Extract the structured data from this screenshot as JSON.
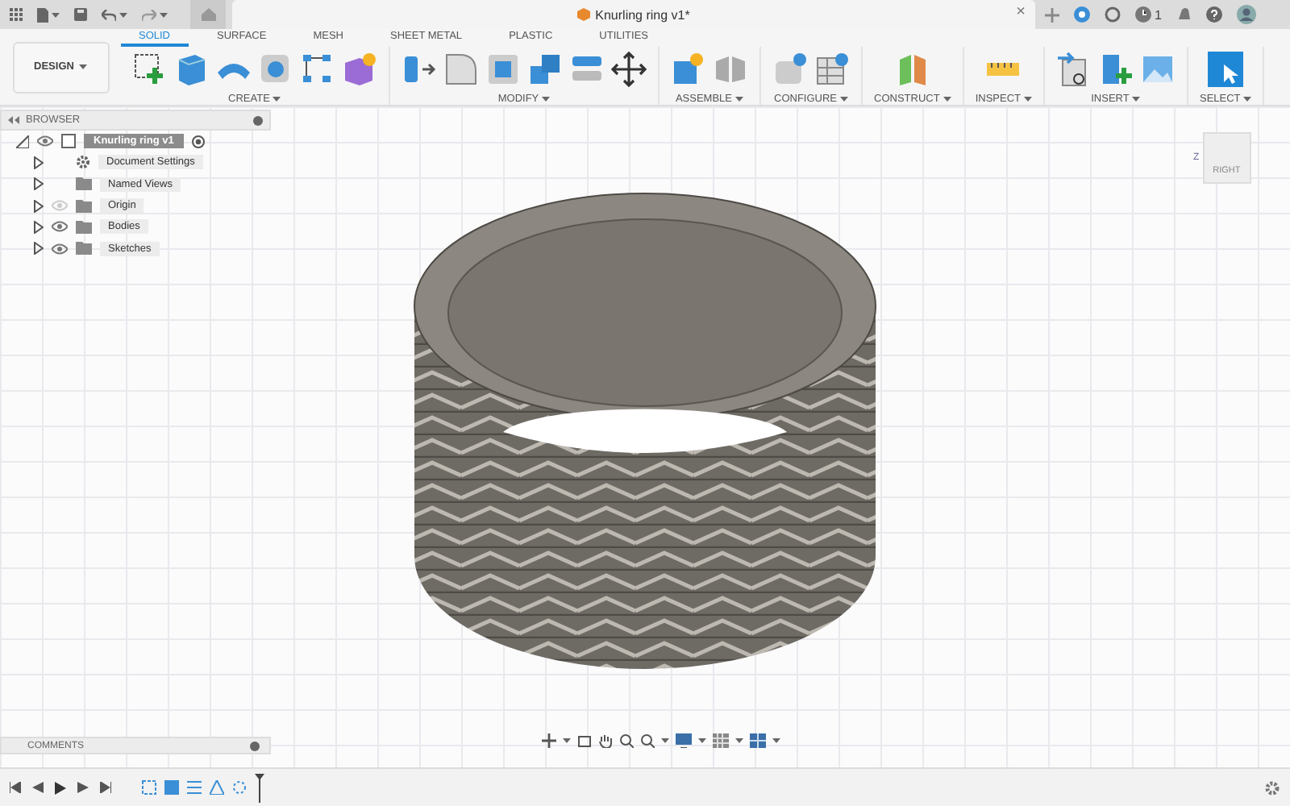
{
  "topbar": {
    "document_title": "Knurling ring v1*",
    "close": "×",
    "notification_count": "1"
  },
  "workspace": {
    "label": "DESIGN"
  },
  "tabs": [
    {
      "label": "SOLID",
      "selected": true
    },
    {
      "label": "SURFACE",
      "selected": false
    },
    {
      "label": "MESH",
      "selected": false
    },
    {
      "label": "SHEET METAL",
      "selected": false
    },
    {
      "label": "PLASTIC",
      "selected": false
    },
    {
      "label": "UTILITIES",
      "selected": false
    }
  ],
  "tool_groups": [
    {
      "label": "CREATE"
    },
    {
      "label": "MODIFY"
    },
    {
      "label": "ASSEMBLE"
    },
    {
      "label": "CONFIGURE"
    },
    {
      "label": "CONSTRUCT"
    },
    {
      "label": "INSPECT"
    },
    {
      "label": "INSERT"
    },
    {
      "label": "SELECT"
    }
  ],
  "browser": {
    "title": "BROWSER",
    "root": {
      "label": "Knurling ring v1",
      "expanded": true,
      "visible": true,
      "children": [
        {
          "label": "Document Settings",
          "kind": "settings",
          "expanded": false
        },
        {
          "label": "Named Views",
          "kind": "folder",
          "expanded": false
        },
        {
          "label": "Origin",
          "kind": "layer",
          "expanded": false,
          "visible": false
        },
        {
          "label": "Bodies",
          "kind": "layer",
          "expanded": false,
          "visible": true
        },
        {
          "label": "Sketches",
          "kind": "layer",
          "expanded": false,
          "visible": true
        }
      ]
    }
  },
  "viewcube": {
    "face": "RIGHT",
    "axis_label": "Z"
  },
  "comments": {
    "title": "COMMENTS"
  }
}
